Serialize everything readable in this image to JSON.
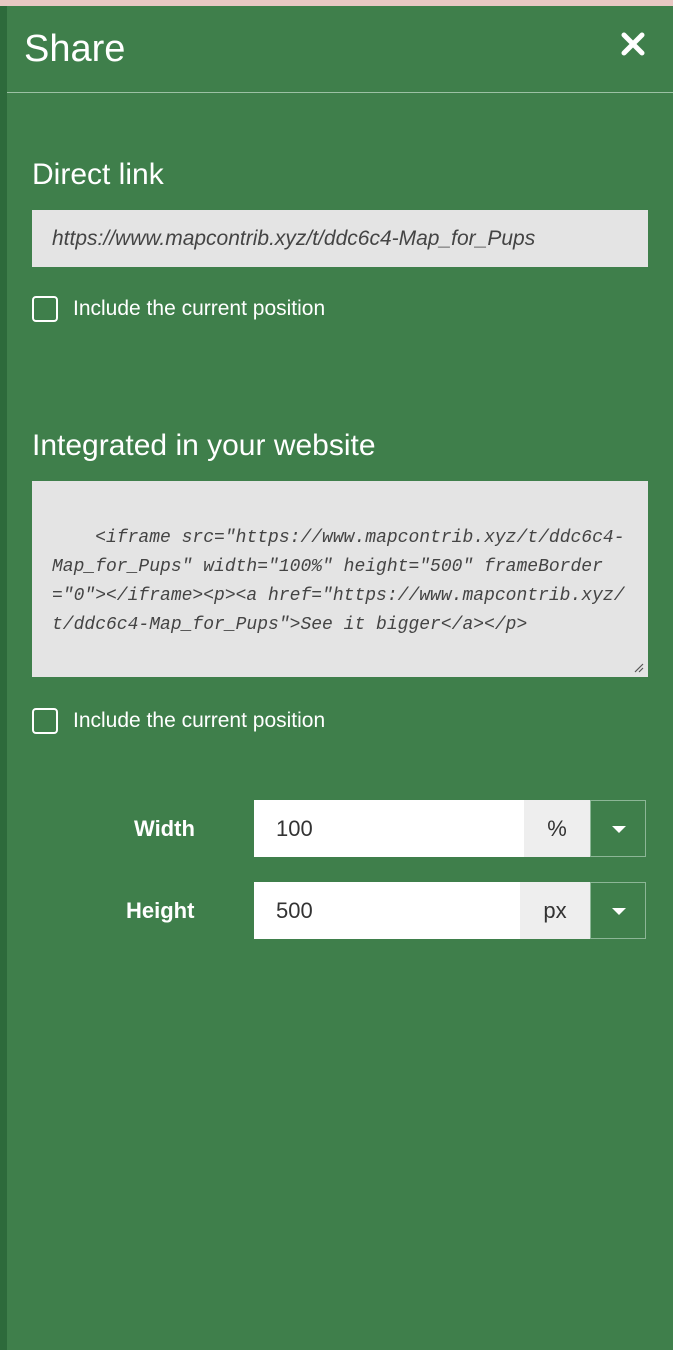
{
  "header": {
    "title": "Share"
  },
  "direct_link": {
    "title": "Direct link",
    "url": "https://www.mapcontrib.xyz/t/ddc6c4-Map_for_Pups",
    "checkbox_label": "Include the current position"
  },
  "integrated": {
    "title": "Integrated in your website",
    "code": "<iframe src=\"https://www.mapcontrib.xyz/t/ddc6c4-Map_for_Pups\" width=\"100%\" height=\"500\" frameBorder=\"0\"></iframe><p><a href=\"https://www.mapcontrib.xyz/t/ddc6c4-Map_for_Pups\">See it bigger</a></p>",
    "checkbox_label": "Include the current position"
  },
  "size": {
    "width_label": "Width",
    "width_value": "100",
    "width_unit": "%",
    "height_label": "Height",
    "height_value": "500",
    "height_unit": "px"
  },
  "colors": {
    "panel": "#3f7f4b",
    "field": "#e4e4e4"
  },
  "icons": [
    "close-icon",
    "chevron-down-icon",
    "resize-grip-icon"
  ]
}
